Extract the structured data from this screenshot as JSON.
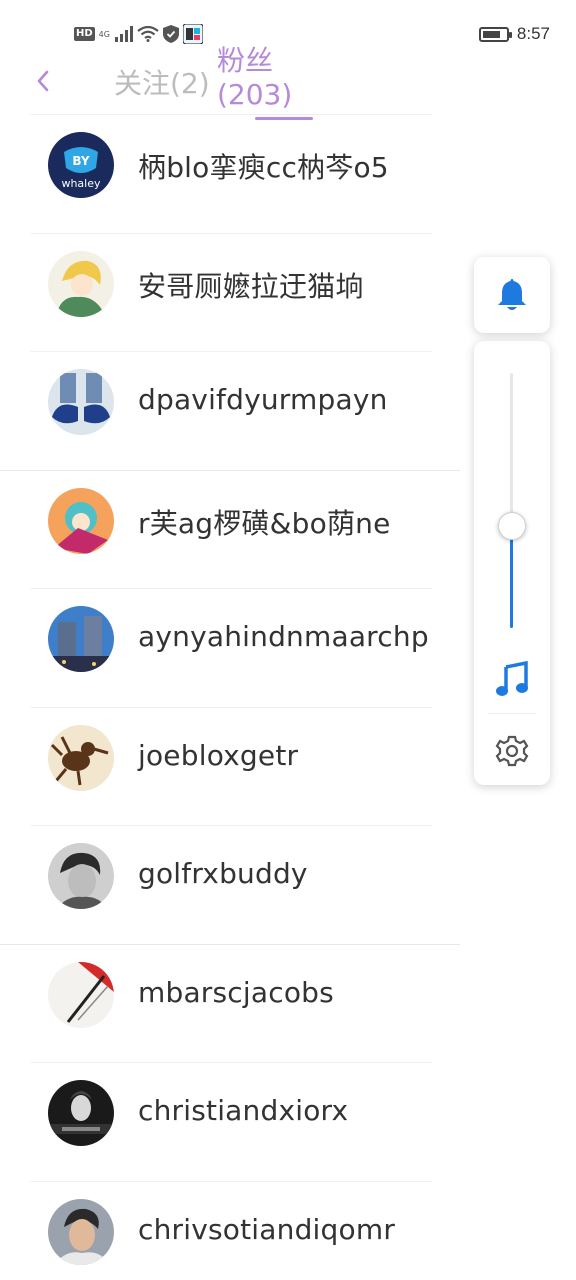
{
  "status_bar": {
    "network_badge": "HD",
    "network_type": "4G",
    "time": "8:57",
    "battery_level": 0.75
  },
  "header": {
    "back_icon": "chevron-left-icon",
    "tab_following": "关注(2)",
    "tab_fans_line1": "粉丝",
    "tab_fans_line2": "(203)",
    "active_color": "#b58ad8"
  },
  "followers": [
    {
      "name": "柄blo挛瘐cc枘芩o5",
      "avatar": "whale-logo"
    },
    {
      "name": "安哥厕嬷拉迂猫垧",
      "avatar": "anime-boy"
    },
    {
      "name": "dpavifdyurmpayn",
      "avatar": "sneakers"
    },
    {
      "name": "r芙ag椤磺&bo荫ne",
      "avatar": "anime-girl"
    },
    {
      "name": "aynyahindnmaarchp",
      "avatar": "city-building"
    },
    {
      "name": "joebloxgetr",
      "avatar": "bird-drawing"
    },
    {
      "name": "golfrxbuddy",
      "avatar": "portrait-bw"
    },
    {
      "name": "mbarscjacobs",
      "avatar": "abstract-red"
    },
    {
      "name": "christiandxiorx",
      "avatar": "dark-portrait"
    },
    {
      "name": "chrivsotiandiqomr",
      "avatar": "man-selfie"
    }
  ],
  "volume_panel": {
    "bell_icon": "bell-icon",
    "music_icon": "music-note-icon",
    "settings_icon": "gear-icon",
    "volume_level": 0.4,
    "accent_color": "#1f7ae0"
  }
}
